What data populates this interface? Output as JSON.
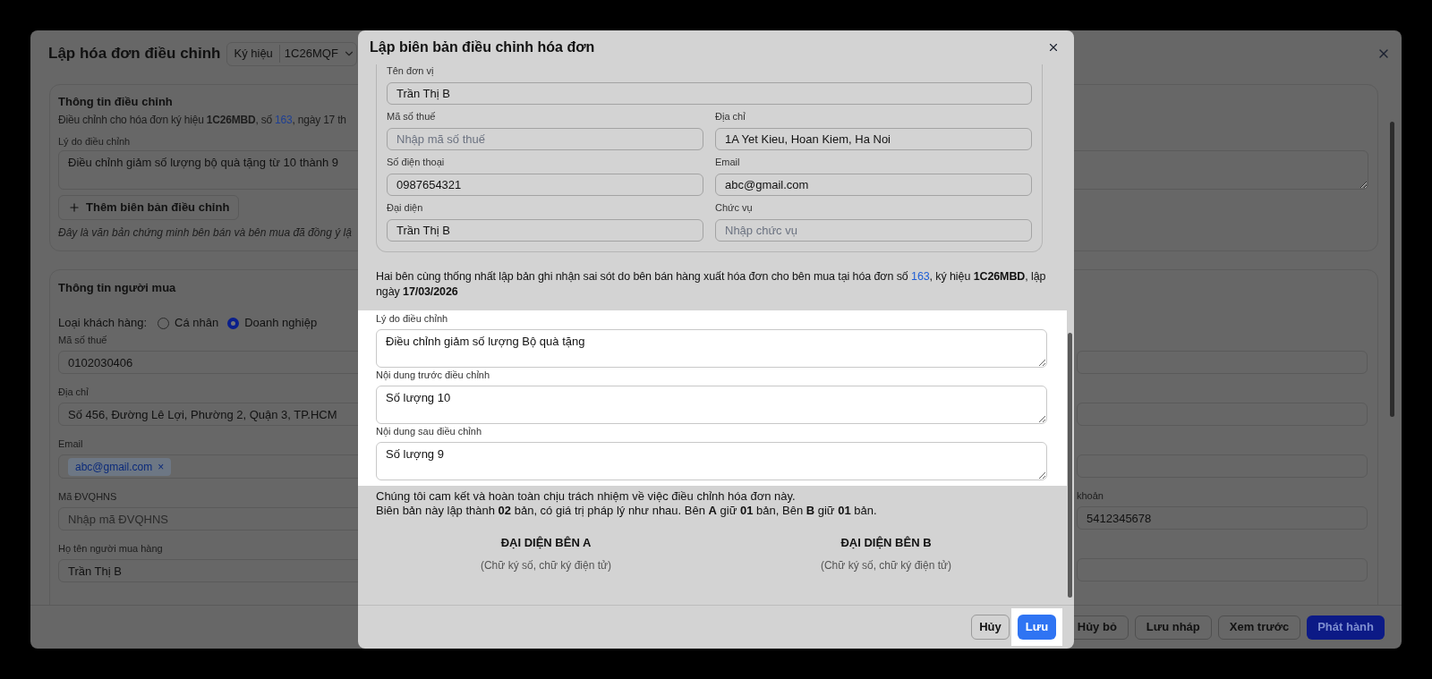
{
  "main_dialog": {
    "title": "Lập hóa đơn điều chỉnh",
    "symbol_select": {
      "label": "Ký hiệu",
      "value": "1C26MQF"
    },
    "adjustment_info": {
      "title": "Thông tin điều chỉnh",
      "description": {
        "before": "Điều chỉnh cho hóa đơn ký hiệu **1C26MBD**, số ",
        "link": "163",
        "after": ", ngày 17 th"
      },
      "reason_label": "Lý do điều chỉnh",
      "reason_value": "Điều chỉnh giảm số lượng bộ quà tặng từ 10 thành 9",
      "add_button": "Thêm biên bản điều chỉnh",
      "note": "Đây là văn bản chứng minh bên bán và bên mua đã đồng ý lậ"
    },
    "buyer_info": {
      "title": "Thông tin người mua",
      "customer_type": {
        "label": "Loại khách hàng:",
        "options": [
          {
            "label": "Cá nhân",
            "selected": false
          },
          {
            "label": "Doanh nghiệp",
            "selected": true
          }
        ]
      },
      "fields": [
        {
          "kind": "text",
          "label": "Mã số thuế",
          "value": "0102030406"
        },
        {
          "kind": "text",
          "label": "Địa chỉ",
          "value": "Số 456, Đường Lê Lợi, Phường 2, Quận 3, TP.HCM"
        },
        {
          "kind": "chips",
          "label": "Email",
          "chips": [
            {
              "text": "abc@gmail.com",
              "remove": "×"
            }
          ]
        },
        {
          "kind": "text",
          "label": "Mã ĐVQHNS",
          "placeholder": "Nhập mã ĐVQHNS"
        },
        {
          "kind": "text",
          "label": "Họ tên người mua hàng",
          "value": "Trần Thị B"
        }
      ],
      "right_fields": [
        {
          "kind": "blank"
        },
        {
          "kind": "blank"
        },
        {
          "kind": "blank"
        },
        {
          "kind": "text",
          "label": "khoản",
          "value": "5412345678"
        },
        {
          "kind": "blank"
        }
      ]
    },
    "footer_buttons": [
      {
        "label": "Hủy bỏ",
        "kind": "outline"
      },
      {
        "label": "Lưu nháp",
        "kind": "outline"
      },
      {
        "label": "Xem trước",
        "kind": "outline"
      },
      {
        "label": "Phát hành",
        "kind": "primary"
      }
    ]
  },
  "modal": {
    "title": "Lập biên bản điều chỉnh hóa đơn",
    "unit": {
      "label": "Tên đơn vị",
      "value": "Trần Thị B"
    },
    "fields": [
      {
        "label": "Mã số thuế",
        "placeholder": "Nhập mã số thuế"
      },
      {
        "label": "Địa chỉ",
        "value": "1A Yet Kieu, Hoan Kiem, Ha Noi"
      },
      {
        "label": "Số điện thoại",
        "value": "0987654321"
      },
      {
        "label": "Email",
        "value": "abc@gmail.com"
      },
      {
        "label": "Đại diện",
        "value": "Trần Thị B"
      },
      {
        "label": "Chức vụ",
        "placeholder": "Nhập chức vụ"
      }
    ],
    "agreement": {
      "before": "Hai bên cùng thống nhất lập bản ghi nhận sai sót do bên bán hàng xuất hóa đơn cho bên mua tại hóa đơn số ",
      "link": "163",
      "after": ", ký hiệu **1C26MBD**, lập ngày **17/03/2026**"
    },
    "adjustments": [
      {
        "label": "Lý do điều chỉnh",
        "value": "Điều chỉnh giảm số lượng Bộ quà tặng"
      },
      {
        "label": "Nội dung trước điều chỉnh",
        "value": "Số lượng 10"
      },
      {
        "label": "Nội dung sau điều chỉnh",
        "value": "Số lượng 9"
      }
    ],
    "commitment": [
      "Chúng tôi cam kết và hoàn toàn chịu trách nhiệm về việc điều chỉnh hóa đơn này.",
      "Biên bản này lập thành **02** bản, có giá trị pháp lý như nhau. Bên **A** giữ **01** bản, Bên **B** giữ **01** bản."
    ],
    "signatures": [
      {
        "title": "ĐẠI DIỆN BÊN A",
        "note": "(Chữ ký số, chữ ký điện tử)"
      },
      {
        "title": "ĐẠI DIỆN BÊN B",
        "note": "(Chữ ký số, chữ ký điện tử)"
      }
    ],
    "buttons": [
      {
        "label": "Hủy",
        "kind": "outline"
      },
      {
        "label": "Lưu",
        "kind": "primary"
      }
    ]
  }
}
